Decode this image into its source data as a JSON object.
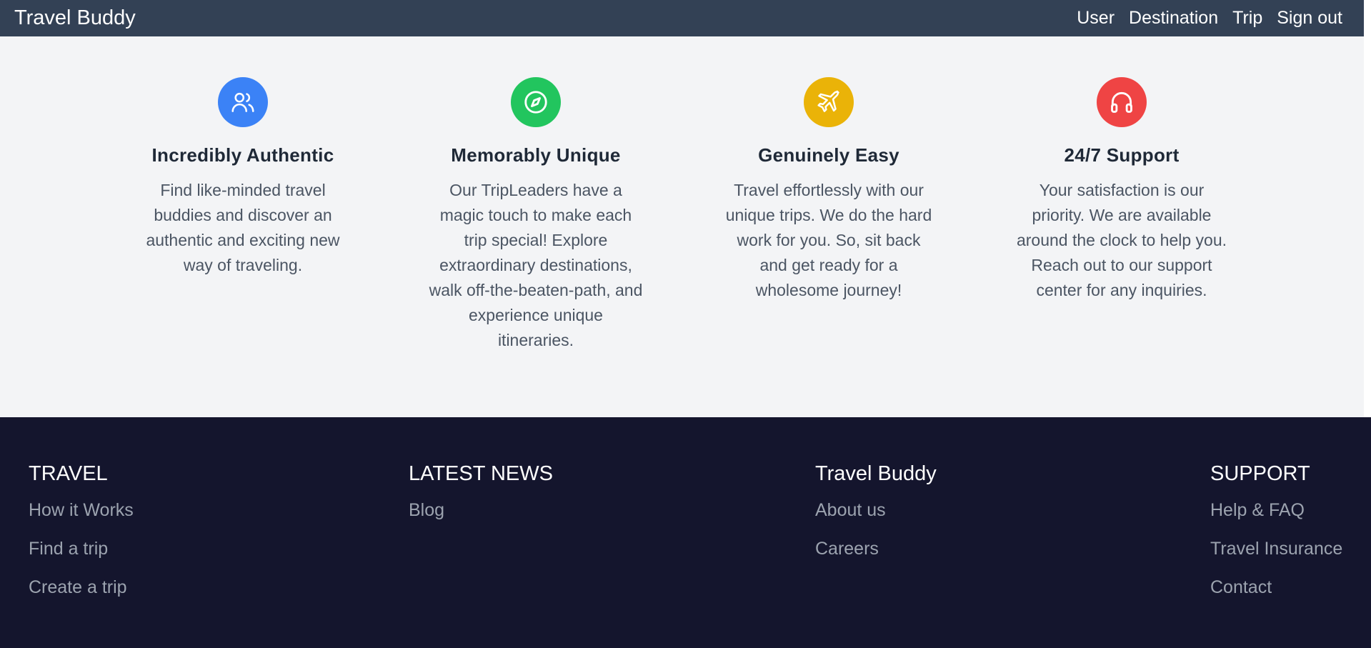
{
  "navbar": {
    "brand": "Travel Buddy",
    "links": [
      "User",
      "Destination",
      "Trip",
      "Sign out"
    ],
    "bg_color": "#334155"
  },
  "features": [
    {
      "icon": "users-icon",
      "icon_color": "#3b82f6",
      "title": "Incredibly Authentic",
      "text": "Find like-minded travel buddies and discover an authentic and exciting new way of traveling."
    },
    {
      "icon": "compass-icon",
      "icon_color": "#22c55e",
      "title": "Memorably Unique",
      "text": "Our TripLeaders have a magic touch to make each trip special! Explore extraordinary destinations, walk off-the-beaten-path, and experience unique itineraries."
    },
    {
      "icon": "plane-icon",
      "icon_color": "#eab308",
      "title": "Genuinely Easy",
      "text": "Travel effortlessly with our unique trips. We do the hard work for you. So, sit back and get ready for a wholesome journey!"
    },
    {
      "icon": "headphones-icon",
      "icon_color": "#ef4444",
      "title": "24/7 Support",
      "text": "Your satisfaction is our priority. We are available around the clock to help you. Reach out to our support center for any inquiries."
    }
  ],
  "footer": {
    "bg_color": "#14152d",
    "columns": [
      {
        "heading": "TRAVEL",
        "links": [
          "How it Works",
          "Find a trip",
          "Create a trip"
        ]
      },
      {
        "heading": "LATEST NEWS",
        "links": [
          "Blog"
        ]
      },
      {
        "heading": "Travel Buddy",
        "links": [
          "About us",
          "Careers"
        ]
      },
      {
        "heading": "SUPPORT",
        "links": [
          "Help & FAQ",
          "Travel Insurance",
          "Contact"
        ]
      }
    ]
  }
}
